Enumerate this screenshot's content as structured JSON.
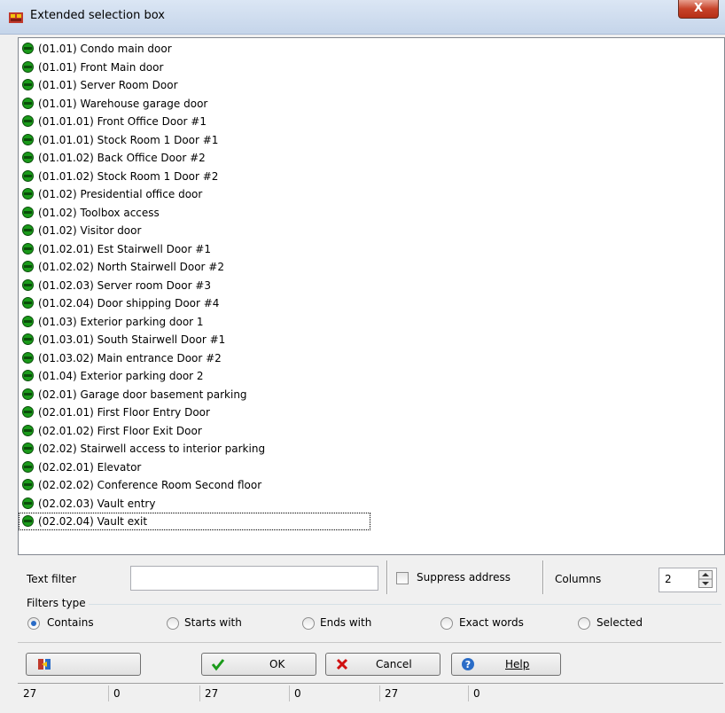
{
  "window": {
    "title": "Extended selection box",
    "close_label": "X"
  },
  "list": {
    "items": [
      "(01.01) Condo main door",
      "(01.01) Front Main door",
      "(01.01) Server Room Door",
      "(01.01) Warehouse garage door",
      "(01.01.01) Front Office Door #1",
      "(01.01.01) Stock Room 1 Door #1",
      "(01.01.02) Back Office Door #2",
      "(01.01.02) Stock Room 1 Door #2",
      "(01.02) Presidential office door",
      "(01.02) Toolbox access",
      "(01.02) Visitor door",
      "(01.02.01) Est Stairwell Door #1",
      "(01.02.02) North Stairwell Door #2",
      "(01.02.03) Server room Door #3",
      "(01.02.04) Door shipping Door #4",
      "(01.03) Exterior parking door 1",
      "(01.03.01) South Stairwell Door #1",
      "(01.03.02) Main entrance Door #2",
      "(01.04) Exterior parking door 2",
      "(02.01) Garage door basement parking",
      "(02.01.01) First Floor Entry Door",
      "(02.01.02) First Floor Exit Door",
      "(02.02) Stairwell access to interior parking",
      "(02.02.01) Elevator",
      "(02.02.02) Conference Room Second floor",
      "(02.02.03) Vault entry",
      "(02.02.04) Vault exit"
    ],
    "focused_item": "(02.02.04) Vault exit",
    "item_icon": "green-door-icon"
  },
  "filter": {
    "text_filter_label": "Text filter",
    "text_filter_value": "",
    "suppress_address_label": "Suppress address",
    "suppress_address_checked": false,
    "columns_label": "Columns",
    "columns_value": "2"
  },
  "filters_type": {
    "group_label": "Filters type",
    "options": [
      "Contains",
      "Starts with",
      "Ends with",
      "Exact words",
      "Selected"
    ],
    "selected": "Contains"
  },
  "buttons": {
    "ok_label": "OK",
    "cancel_label": "Cancel",
    "help_label": "Help"
  },
  "status_bar": [
    "27",
    "0",
    "27",
    "0",
    "27",
    "0"
  ],
  "colors": {
    "accent": "#2a6cc7",
    "door_green": "#1a9a1a"
  }
}
